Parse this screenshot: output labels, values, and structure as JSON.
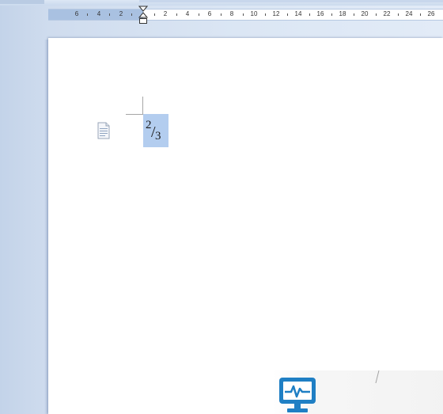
{
  "ruler": {
    "labels_left": [
      "6",
      "4",
      "2"
    ],
    "labels_right": [
      "2",
      "4",
      "6",
      "8",
      "10",
      "12",
      "14",
      "16",
      "18",
      "20",
      "22",
      "24",
      "26"
    ]
  },
  "document": {
    "formula": {
      "numerator": "2",
      "separator": "/",
      "denominator": "3",
      "selected": true
    },
    "object_icon": "document-object-icon"
  },
  "watermark": {
    "logo_icon": "monitor-pulse-icon",
    "colors": {
      "primary": "#1f7fc4",
      "text": "#ffffff"
    }
  },
  "colors": {
    "workspace": "#d6e2f2",
    "ruler_margin": "#a9c1e1",
    "selection": "#b3cdef",
    "page": "#ffffff"
  }
}
